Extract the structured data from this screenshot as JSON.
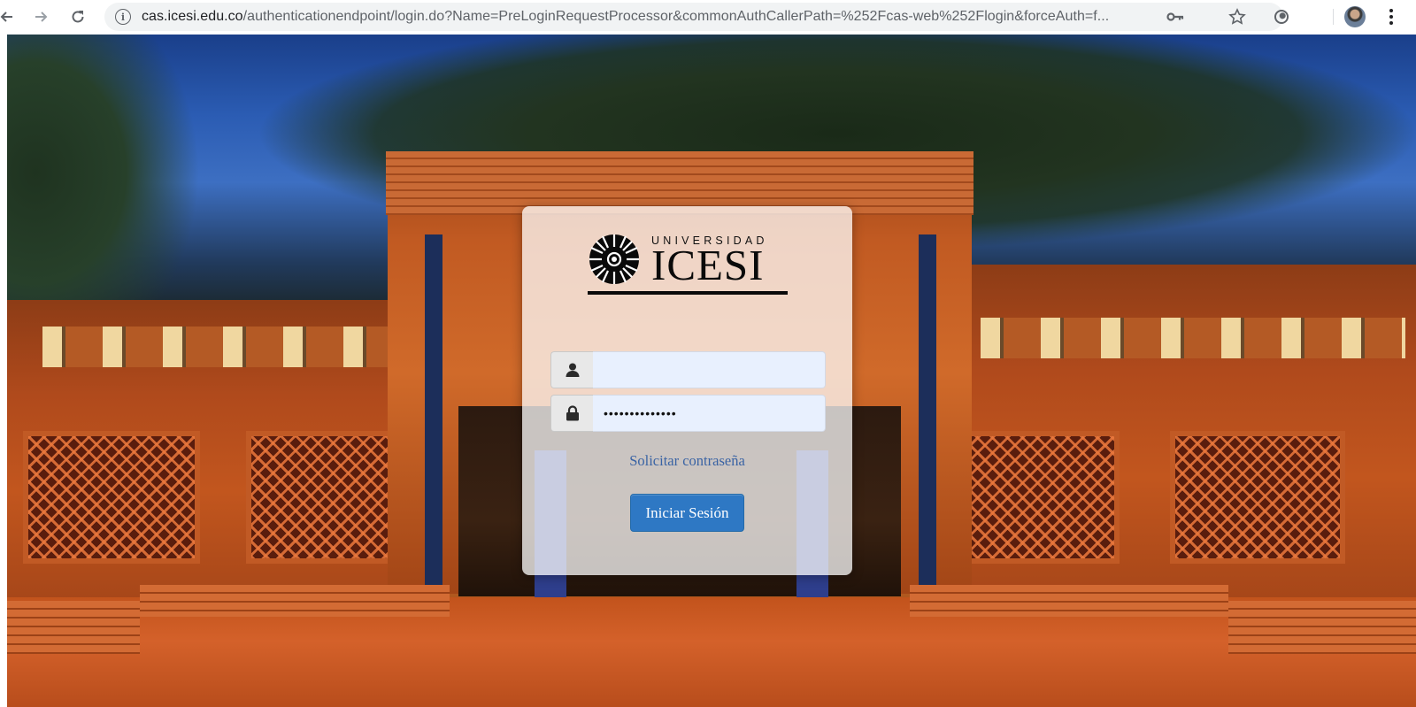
{
  "browser": {
    "url_host": "cas.icesi.edu.co",
    "url_path": "/authenticationendpoint/login.do?Name=PreLoginRequestProcessor&commonAuthCallerPath=%252Fcas-web%252Flogin&forceAuth=f...",
    "icons": {
      "back": "back-arrow-icon",
      "forward": "forward-arrow-icon",
      "reload": "reload-icon",
      "info": "site-info-icon",
      "key": "key-icon",
      "star": "bookmark-star-icon",
      "extension": "extension-icon",
      "menu": "kebab-menu-icon"
    }
  },
  "logo": {
    "top_text": "UNIVERSIDAD",
    "main_text": "ICESI"
  },
  "login": {
    "username_value": "",
    "password_value": "••••••••••••••",
    "forgot_link": "Solicitar contraseña",
    "submit_label": "Iniciar Sesión",
    "accent_color": "#2e78c4"
  }
}
